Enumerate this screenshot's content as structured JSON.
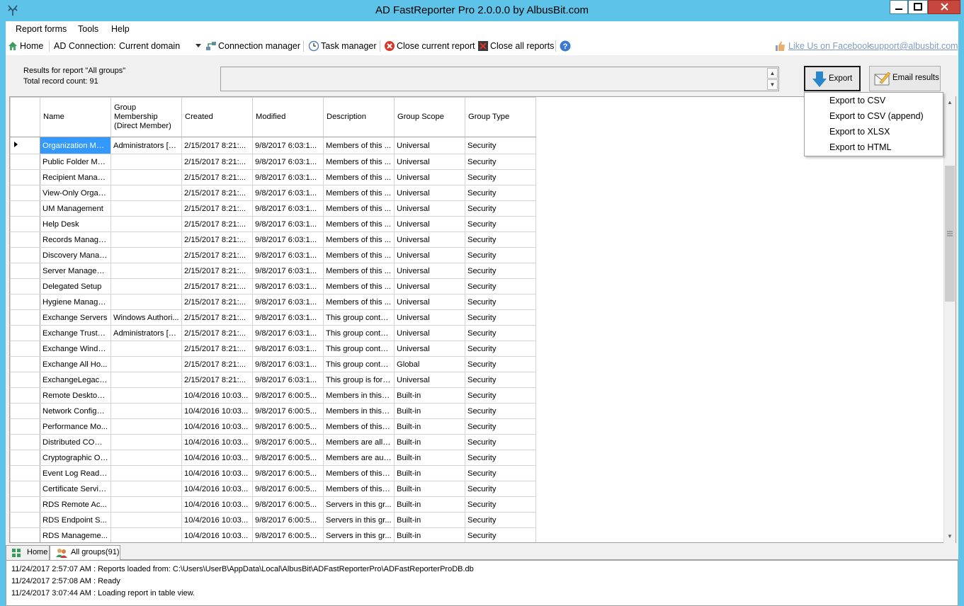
{
  "window": {
    "title": "AD FastReporter Pro 2.0.0.0 by AlbusBit.com"
  },
  "menu": {
    "items": [
      "Report forms",
      "Tools",
      "Help"
    ]
  },
  "toolbar": {
    "home": "Home",
    "ad_connection_label": "AD Connection:",
    "ad_connection_value": "Current domain",
    "connection_manager": "Connection manager",
    "task_manager": "Task manager",
    "close_current": "Close current report",
    "close_all": "Close all reports",
    "facebook_link": "Like Us on Facebook",
    "support_link": "support@albusbit.com"
  },
  "results": {
    "line1": "Results for report \"All groups\"",
    "line2": "Total record count: 91"
  },
  "export": {
    "button": "Export",
    "email_button": "Email results",
    "menu": [
      "Export to CSV",
      "Export to CSV (append)",
      "Export to XLSX",
      "Export to HTML"
    ]
  },
  "grid": {
    "columns": [
      "Name",
      "Group Membership (Direct Member)",
      "Created",
      "Modified",
      "Description",
      "Group Scope",
      "Group Type"
    ],
    "rows": [
      [
        "Organization Man...",
        "Administrators [B...",
        "2/15/2017 8:21:...",
        "9/8/2017 6:03:1...",
        "Members of this ...",
        "Universal",
        "Security"
      ],
      [
        "Public Folder Ma...",
        "",
        "2/15/2017 8:21:...",
        "9/8/2017 6:03:1...",
        "Members of this ...",
        "Universal",
        "Security"
      ],
      [
        "Recipient Manag...",
        "",
        "2/15/2017 8:21:...",
        "9/8/2017 6:03:1...",
        "Members of this ...",
        "Universal",
        "Security"
      ],
      [
        "View-Only Organi...",
        "",
        "2/15/2017 8:21:...",
        "9/8/2017 6:03:1...",
        "Members of this ...",
        "Universal",
        "Security"
      ],
      [
        "UM Management",
        "",
        "2/15/2017 8:21:...",
        "9/8/2017 6:03:1...",
        "Members of this ...",
        "Universal",
        "Security"
      ],
      [
        "Help Desk",
        "",
        "2/15/2017 8:21:...",
        "9/8/2017 6:03:1...",
        "Members of this ...",
        "Universal",
        "Security"
      ],
      [
        "Records Manage...",
        "",
        "2/15/2017 8:21:...",
        "9/8/2017 6:03:1...",
        "Members of this ...",
        "Universal",
        "Security"
      ],
      [
        "Discovery Manag...",
        "",
        "2/15/2017 8:21:...",
        "9/8/2017 6:03:1...",
        "Members of this ...",
        "Universal",
        "Security"
      ],
      [
        "Server Managem...",
        "",
        "2/15/2017 8:21:...",
        "9/8/2017 6:03:1...",
        "Members of this ...",
        "Universal",
        "Security"
      ],
      [
        "Delegated Setup",
        "",
        "2/15/2017 8:21:...",
        "9/8/2017 6:03:1...",
        "Members of this ...",
        "Universal",
        "Security"
      ],
      [
        "Hygiene Manage...",
        "",
        "2/15/2017 8:21:...",
        "9/8/2017 6:03:1...",
        "Members of this ...",
        "Universal",
        "Security"
      ],
      [
        "Exchange Servers",
        "Windows Authori...",
        "2/15/2017 8:21:...",
        "9/8/2017 6:03:1...",
        "This group contai...",
        "Universal",
        "Security"
      ],
      [
        "Exchange Truste...",
        "Administrators [B...",
        "2/15/2017 8:21:...",
        "9/8/2017 6:03:1...",
        "This group contai...",
        "Universal",
        "Security"
      ],
      [
        "Exchange Windo...",
        "",
        "2/15/2017 8:21:...",
        "9/8/2017 6:03:1...",
        "This group contai...",
        "Universal",
        "Security"
      ],
      [
        "Exchange All Ho...",
        "",
        "2/15/2017 8:21:...",
        "9/8/2017 6:03:1...",
        "This group contai...",
        "Global",
        "Security"
      ],
      [
        "ExchangeLegacy...",
        "",
        "2/15/2017 8:21:...",
        "9/8/2017 6:03:1...",
        "This group is for i...",
        "Universal",
        "Security"
      ],
      [
        "Remote Desktop ...",
        "",
        "10/4/2016 10:03...",
        "9/8/2017 6:00:5...",
        "Members in this g...",
        "Built-in",
        "Security"
      ],
      [
        "Network Configur...",
        "",
        "10/4/2016 10:03...",
        "9/8/2017 6:00:5...",
        "Members in this g...",
        "Built-in",
        "Security"
      ],
      [
        "Performance Mo...",
        "",
        "10/4/2016 10:03...",
        "9/8/2017 6:00:5...",
        "Members of this g...",
        "Built-in",
        "Security"
      ],
      [
        "Distributed COM ...",
        "",
        "10/4/2016 10:03...",
        "9/8/2017 6:00:5...",
        "Members are allo...",
        "Built-in",
        "Security"
      ],
      [
        "Cryptographic Op...",
        "",
        "10/4/2016 10:03...",
        "9/8/2017 6:00:5...",
        "Members are aut...",
        "Built-in",
        "Security"
      ],
      [
        "Event Log Readers",
        "",
        "10/4/2016 10:03...",
        "9/8/2017 6:00:5...",
        "Members of this g...",
        "Built-in",
        "Security"
      ],
      [
        "Certificate Servic...",
        "",
        "10/4/2016 10:03...",
        "9/8/2017 6:00:5...",
        "Members of this g...",
        "Built-in",
        "Security"
      ],
      [
        "RDS Remote Ac...",
        "",
        "10/4/2016 10:03...",
        "9/8/2017 6:00:5...",
        "Servers in this gr...",
        "Built-in",
        "Security"
      ],
      [
        "RDS Endpoint S...",
        "",
        "10/4/2016 10:03...",
        "9/8/2017 6:00:5...",
        "Servers in this gr...",
        "Built-in",
        "Security"
      ],
      [
        "RDS Manageme...",
        "",
        "10/4/2016 10:03...",
        "9/8/2017 6:00:5...",
        "Servers in this gr...",
        "Built-in",
        "Security"
      ]
    ]
  },
  "tabs": {
    "home": "Home",
    "report": "All groups(91)"
  },
  "log": {
    "lines": [
      "11/24/2017 2:57:07 AM : Reports loaded from: C:\\Users\\UserB\\AppData\\Local\\AlbusBit\\ADFastReporterPro\\ADFastReporterProDB.db",
      "11/24/2017 2:57:08 AM : Ready",
      "11/24/2017 3:07:44 AM : Loading report in table view."
    ]
  },
  "colors": {
    "titlebar": "#5ec3e8",
    "selection": "#3399ff",
    "close_button": "#c7463d",
    "link": "#7f9cbf"
  }
}
